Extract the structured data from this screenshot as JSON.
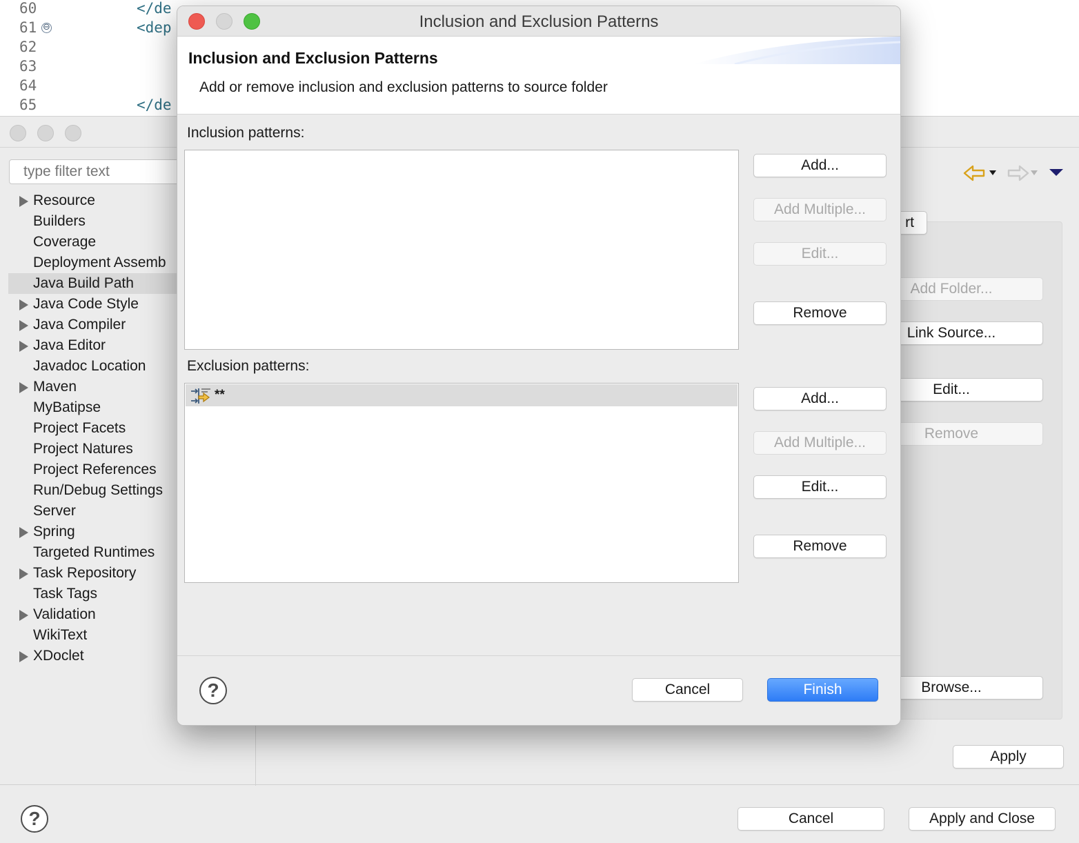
{
  "editor": {
    "lines": [
      {
        "num": "60",
        "code": "</de"
      },
      {
        "num": "61",
        "code": "<dep",
        "fold": "⊖"
      },
      {
        "num": "62",
        "code": ""
      },
      {
        "num": "63",
        "code": ""
      },
      {
        "num": "64",
        "code": ""
      },
      {
        "num": "65",
        "code": "</de"
      }
    ]
  },
  "prefs": {
    "filter": {
      "placeholder": "type filter text"
    },
    "tree": [
      {
        "label": "Resource",
        "expandable": true
      },
      {
        "label": "Builders"
      },
      {
        "label": "Coverage"
      },
      {
        "label": "Deployment Assemb"
      },
      {
        "label": "Java Build Path",
        "selected": true
      },
      {
        "label": "Java Code Style",
        "expandable": true
      },
      {
        "label": "Java Compiler",
        "expandable": true
      },
      {
        "label": "Java Editor",
        "expandable": true
      },
      {
        "label": "Javadoc Location"
      },
      {
        "label": "Maven",
        "expandable": true
      },
      {
        "label": "MyBatipse"
      },
      {
        "label": "Project Facets"
      },
      {
        "label": "Project Natures"
      },
      {
        "label": "Project References"
      },
      {
        "label": "Run/Debug Settings"
      },
      {
        "label": "Server"
      },
      {
        "label": "Spring",
        "expandable": true
      },
      {
        "label": "Targeted Runtimes"
      },
      {
        "label": "Task Repository",
        "expandable": true
      },
      {
        "label": "Task Tags"
      },
      {
        "label": "Validation",
        "expandable": true
      },
      {
        "label": "WikiText"
      },
      {
        "label": "XDoclet",
        "expandable": true
      }
    ],
    "right_buttons": {
      "partial": "rt",
      "add_folder": "Add Folder...",
      "link_source": "Link Source...",
      "edit": "Edit...",
      "remove": "Remove",
      "browse": "Browse..."
    },
    "apply": "Apply",
    "cancel": "Cancel",
    "apply_close": "Apply and Close",
    "colors": {
      "back_arrow": "#d9a21b",
      "forward_arrow": "#c9c9c9",
      "menu": "#1e1e6e"
    }
  },
  "dialog": {
    "title": "Inclusion and Exclusion Patterns",
    "header_title": "Inclusion and Exclusion Patterns",
    "header_subtitle": "Add or remove inclusion and exclusion patterns to source folder",
    "inclusion": {
      "label": "Inclusion patterns:",
      "add": "Add...",
      "add_multiple": "Add Multiple...",
      "edit": "Edit...",
      "remove": "Remove"
    },
    "exclusion": {
      "label": "Exclusion patterns:",
      "items": [
        "**"
      ],
      "add": "Add...",
      "add_multiple": "Add Multiple...",
      "edit": "Edit...",
      "remove": "Remove"
    },
    "cancel": "Cancel",
    "finish": "Finish",
    "help": "?",
    "colors": {
      "close": "#ee5a52",
      "minimize": "#d7d7d7",
      "zoom": "#4fc243",
      "accent": "#2e7cf6"
    }
  }
}
